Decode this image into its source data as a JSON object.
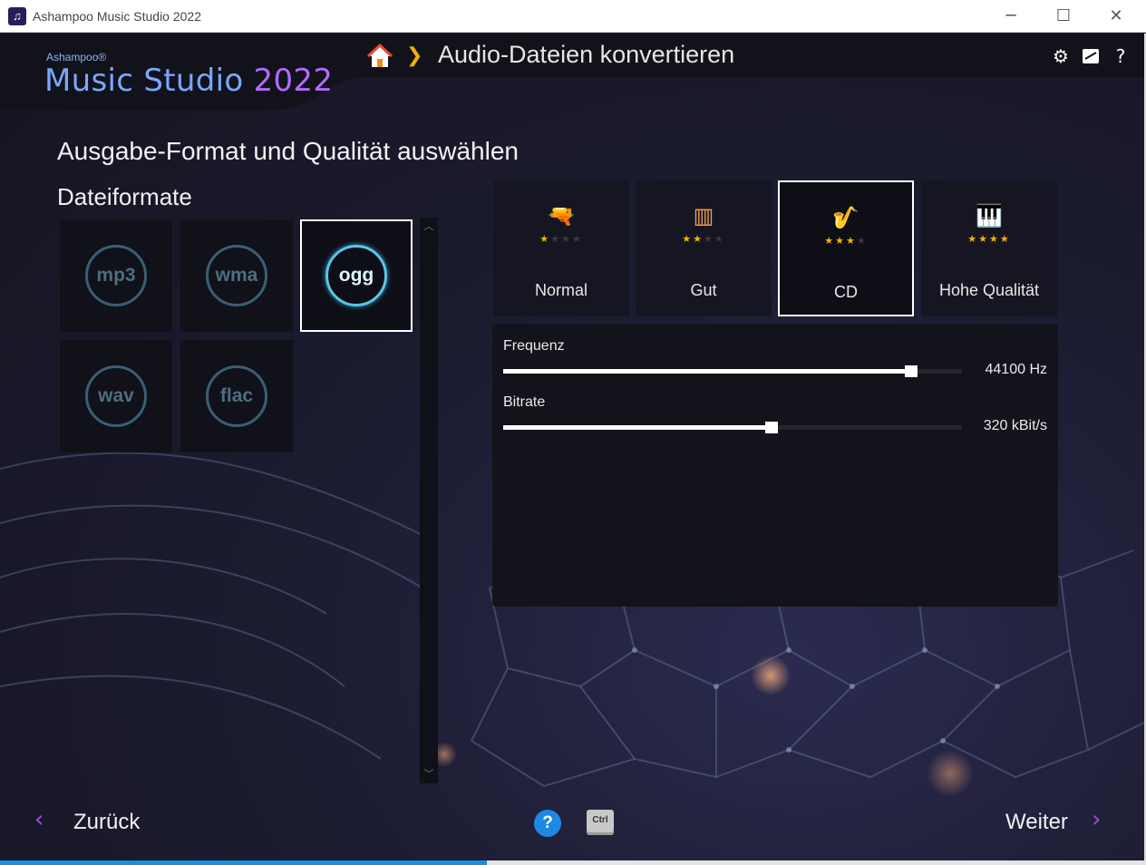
{
  "window": {
    "title": "Ashampoo Music Studio 2022",
    "minimize_glyph": "─",
    "maximize_glyph": "☐",
    "close_glyph": "✕"
  },
  "brand": {
    "company": "Ashampoo®",
    "product": "Music Studio",
    "year": "2022"
  },
  "header": {
    "title": "Audio-Dateien konvertieren",
    "icons": [
      "home-icon",
      "settings-icon",
      "notes-icon",
      "help-icon"
    ],
    "help_glyph": "?"
  },
  "section_title": "Ausgabe-Format und Qualität auswählen",
  "formats": {
    "title": "Dateiformate",
    "items": [
      {
        "label": "mp3",
        "selected": false
      },
      {
        "label": "wma",
        "selected": false
      },
      {
        "label": "ogg",
        "selected": true
      },
      {
        "label": "wav",
        "selected": false
      },
      {
        "label": "flac",
        "selected": false
      }
    ]
  },
  "quality": {
    "items": [
      {
        "label": "Normal",
        "icon": "water-gun-icon",
        "stars": 1,
        "selected": false
      },
      {
        "label": "Gut",
        "icon": "xylophone-icon",
        "stars": 2,
        "selected": false
      },
      {
        "label": "CD",
        "icon": "saxophone-icon",
        "stars": 3,
        "selected": true
      },
      {
        "label": "Hohe Qualität",
        "icon": "piano-icon",
        "stars": 4,
        "selected": false
      }
    ],
    "max_stars": 4
  },
  "settings": {
    "frequency": {
      "label": "Frequenz",
      "value": "44100 Hz",
      "level": 0.89
    },
    "bitrate": {
      "label": "Bitrate",
      "value": "320 kBit/s",
      "level": 0.585
    }
  },
  "footer": {
    "back_label": "Zurück",
    "next_label": "Weiter",
    "help_glyph": "?",
    "ctrl_label": "Ctrl"
  },
  "status": {
    "progress": 0.425
  },
  "colors": {
    "accent_purple": "#9a4fe0",
    "accent_blue": "#1e88e5",
    "star": "#f6b400",
    "selection_border": "#ffffff",
    "format_ring": "#3a5f74",
    "format_ring_selected": "#5cc4e8"
  }
}
